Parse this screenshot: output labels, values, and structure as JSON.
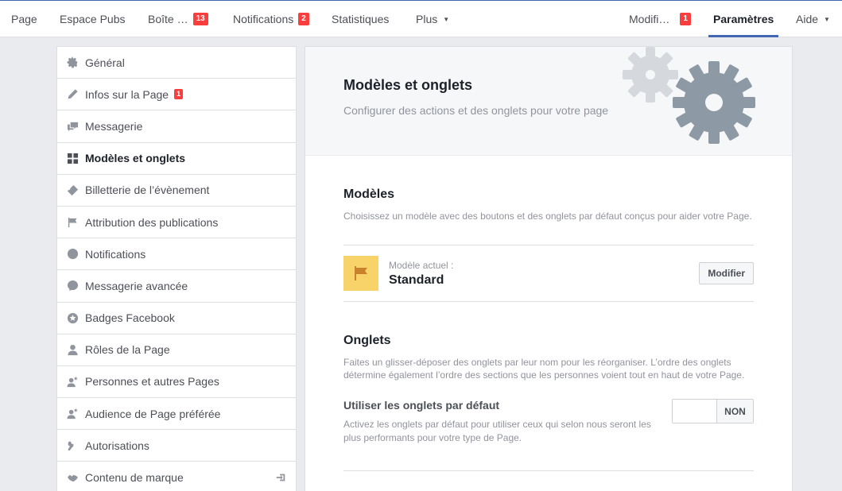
{
  "topnav": {
    "left": [
      {
        "label": "Page"
      },
      {
        "label": "Espace Pubs"
      },
      {
        "label": "Boîte …",
        "badge": "13"
      },
      {
        "label": "Notifications",
        "badge": "2"
      },
      {
        "label": "Statistiques"
      },
      {
        "label": "Plus"
      }
    ],
    "right": [
      {
        "label": "Modifi…",
        "badge": "1"
      },
      {
        "label": "Paramètres"
      },
      {
        "label": "Aide"
      }
    ]
  },
  "sidebar": {
    "items": [
      {
        "label": "Général",
        "icon": "gear-icon"
      },
      {
        "label": "Infos sur la Page",
        "icon": "pencil-icon",
        "badge": "1"
      },
      {
        "label": "Messagerie",
        "icon": "messages-icon"
      },
      {
        "label": "Modèles et onglets",
        "icon": "grid-icon"
      },
      {
        "label": "Billetterie de l’évènement",
        "icon": "ticket-icon"
      },
      {
        "label": "Attribution des publications",
        "icon": "flag-icon"
      },
      {
        "label": "Notifications",
        "icon": "globe-icon"
      },
      {
        "label": "Messagerie avancée",
        "icon": "messenger-icon"
      },
      {
        "label": "Badges Facebook",
        "icon": "star-badge-icon"
      },
      {
        "label": "Rôles de la Page",
        "icon": "person-icon"
      },
      {
        "label": "Personnes et autres Pages",
        "icon": "person-star-icon"
      },
      {
        "label": "Audience de Page préférée",
        "icon": "person-star-icon"
      },
      {
        "label": "Autorisations",
        "icon": "wrench-icon"
      },
      {
        "label": "Contenu de marque",
        "icon": "handshake-icon"
      }
    ]
  },
  "main": {
    "title": "Modèles et onglets",
    "subtitle": "Configurer des actions et des onglets pour votre page",
    "templates": {
      "heading": "Modèles",
      "description": "Choisissez un modèle avec des boutons et des onglets par défaut conçus pour aider votre Page.",
      "current_label": "Modèle actuel :",
      "current_value": "Standard",
      "edit_button": "Modifier"
    },
    "tabs": {
      "heading": "Onglets",
      "description": "Faites un glisser-déposer des onglets par leur nom pour les réorganiser. L’ordre des onglets détermine également l’ordre des sections que les personnes voient tout en haut de votre Page.",
      "default_title": "Utiliser les onglets par défaut",
      "default_description": "Activez les onglets par défaut pour utiliser ceux qui selon nous seront les plus performants pour votre type de Page.",
      "toggle_value": "NON"
    }
  },
  "colors": {
    "accent": "#4267b2",
    "badge": "#fa3e3e",
    "template_icon_bg": "#f7d36a"
  }
}
